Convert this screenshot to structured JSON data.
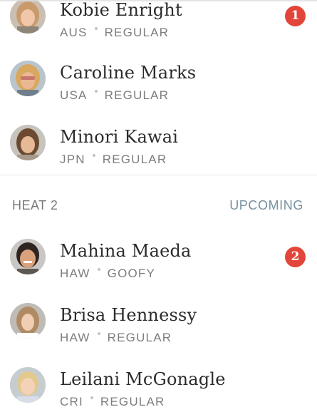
{
  "heats": [
    {
      "surfers": [
        {
          "name": "Kobie Enright",
          "country": "AUS",
          "stance": "REGULAR",
          "badge": "1"
        },
        {
          "name": "Caroline Marks",
          "country": "USA",
          "stance": "REGULAR",
          "badge": ""
        },
        {
          "name": "Minori Kawai",
          "country": "JPN",
          "stance": "REGULAR",
          "badge": ""
        }
      ]
    },
    {
      "title": "HEAT 2",
      "status": "UPCOMING",
      "surfers": [
        {
          "name": "Mahina Maeda",
          "country": "HAW",
          "stance": "GOOFY",
          "badge": "2"
        },
        {
          "name": "Brisa Hennessy",
          "country": "HAW",
          "stance": "REGULAR",
          "badge": ""
        },
        {
          "name": "Leilani McGonagle",
          "country": "CRI",
          "stance": "REGULAR",
          "badge": ""
        }
      ]
    }
  ],
  "colors": {
    "badge": "#e2453a",
    "status": "#7590a0"
  },
  "icons": {
    "avatar": "surfer-avatar-photo"
  }
}
